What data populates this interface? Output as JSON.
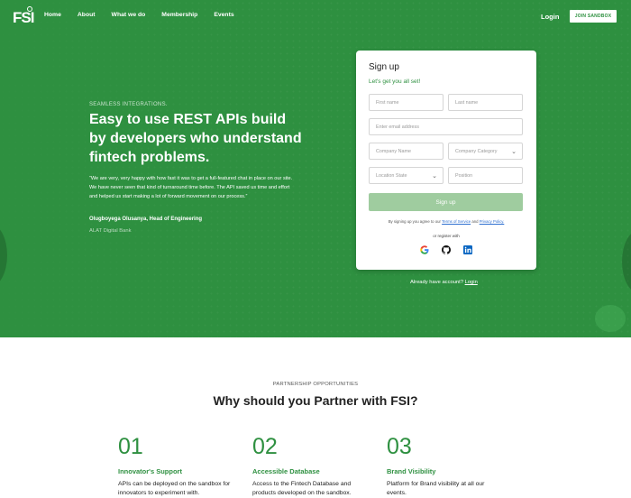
{
  "brand": {
    "logo_text": "FSI",
    "accent": "#2e9040"
  },
  "nav": {
    "items": [
      "Home",
      "About",
      "What we do",
      "Membership",
      "Events"
    ],
    "login": "Login",
    "join_button": "JOIN SANDBOX"
  },
  "hero": {
    "eyebrow": "SEAMLESS INTEGRATIONS.",
    "headline": "Easy to use REST APIs build by developers who understand fintech problems.",
    "quote": "“We are very, very happy with how fast it was to get a full-featured chat in place on our site. We have never seen that kind of turnaround time before. The API saved us time and effort and helped us start making a lot of forward movement on our process.”",
    "author": "Olugboyega Olusanya, Head of Engineering",
    "company": "ALAT Digital Bank"
  },
  "signup": {
    "title": "Sign up",
    "subtitle": "Let's get you all set!",
    "first_name": "First name",
    "last_name": "Last name",
    "email": "Enter email address",
    "company_name": "Company Name",
    "company_category": "Company Category",
    "location_state": "Location State",
    "position": "Position",
    "button": "Sign up",
    "terms_prefix": "By signing up you agree to our",
    "terms_link": "Terms of Service",
    "terms_and": "and",
    "privacy_link": "Privacy Policy.",
    "or_register": "or register with",
    "social": [
      "google-icon",
      "github-icon",
      "linkedin-icon"
    ]
  },
  "account": {
    "text": "Already have account?",
    "link": "Login"
  },
  "partnership": {
    "eyebrow": "PARTNERSHIP OPPORTUNITIES",
    "title": "Why should you Partner with FSI?",
    "features": [
      {
        "num": "01",
        "title": "Innovator's Support",
        "desc": "APIs can be deployed on the sandbox for innovators to experiment with."
      },
      {
        "num": "02",
        "title": "Accessible Database",
        "desc": "Access to the Fintech Database and products developed on the sandbox."
      },
      {
        "num": "03",
        "title": "Brand Visibility",
        "desc": "Platform for Brand visibility at all our events."
      }
    ]
  }
}
